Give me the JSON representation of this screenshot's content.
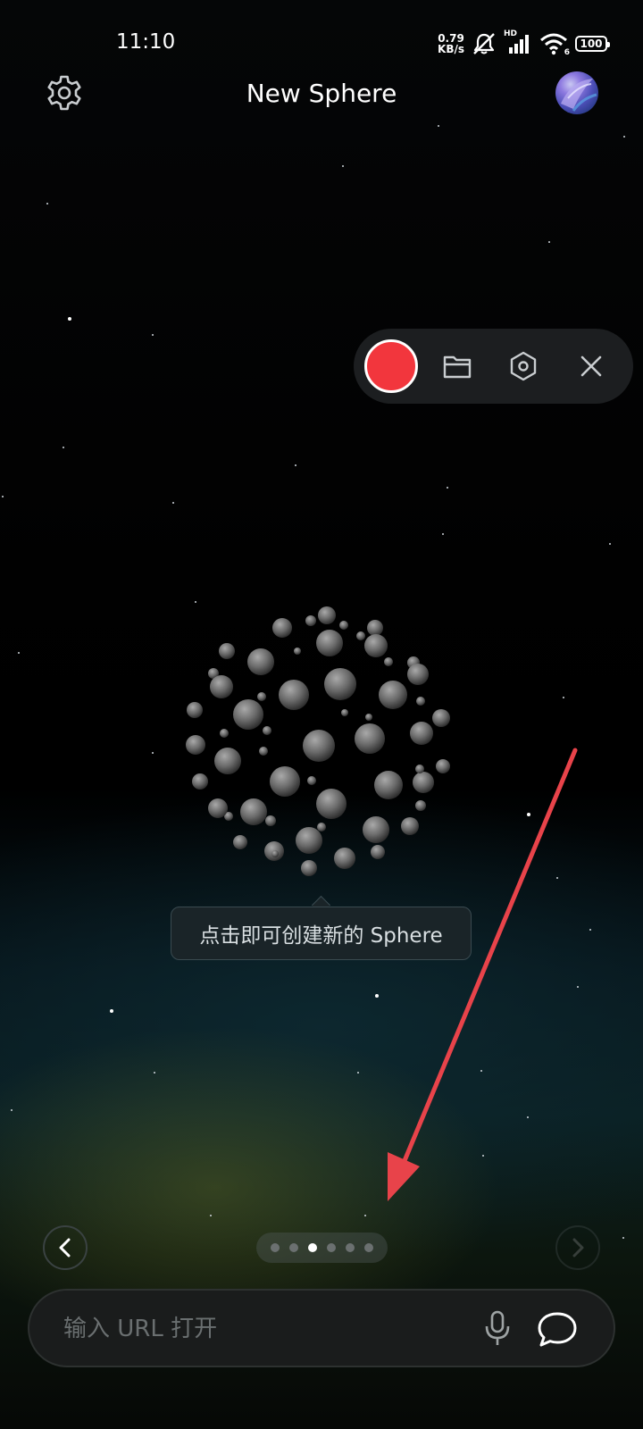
{
  "status_bar": {
    "time": "11:10",
    "net_speed_value": "0.79",
    "net_speed_unit": "KB/s",
    "hd_label": "HD",
    "wifi_label": "6",
    "battery": "100",
    "icons": [
      "muted-bell-icon",
      "cellular-signal-icon",
      "wifi-icon",
      "battery-icon"
    ]
  },
  "header": {
    "title": "New Sphere",
    "settings_icon": "gear-icon",
    "avatar": "user-avatar"
  },
  "recorder_toolbar": {
    "record_color": "#f2363d",
    "icons": [
      "record-icon",
      "folder-icon",
      "hexagon-settings-icon",
      "close-icon"
    ]
  },
  "tooltip": {
    "text": "点击即可创建新的 Sphere"
  },
  "pager": {
    "page_count": 6,
    "active_index": 2,
    "prev_icon": "chevron-left-icon",
    "next_icon": "chevron-right-icon"
  },
  "url_bar": {
    "placeholder": "输入 URL 打开",
    "value": "",
    "mic_icon": "microphone-icon",
    "chat_icon": "chat-bubble-icon"
  },
  "colors": {
    "background": "#000000",
    "annotation_arrow": "#e8434a",
    "record": "#f2363d"
  }
}
